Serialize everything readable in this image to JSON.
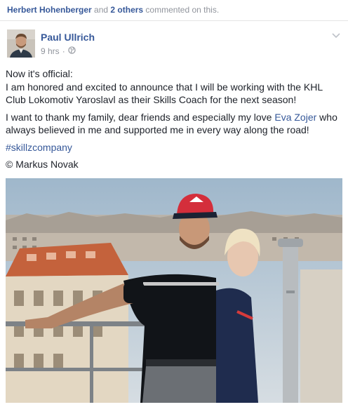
{
  "context": {
    "name1": "Herbert Hohenberger",
    "and": " and ",
    "others": "2 others",
    "suffix": " commented on this."
  },
  "post": {
    "author": "Paul Ullrich",
    "time": "9 hrs",
    "separator": "·",
    "audience_icon": "globe-icon",
    "menu_icon": "chevron-down-icon",
    "line1": "Now it's official:",
    "line2": "I am honored and excited to announce that I will be working with the KHL Club Lokomotiv Yaroslavl as their Skills Coach for the next season!",
    "para2_before": "I want to thank my family, dear friends and especially my love ",
    "para2_link": "Eva Zojer",
    "para2_after": " who always believed in me and supported me in every way along the road!",
    "hashtag": "#skillzcompany",
    "credit": "© Markus Novak"
  },
  "colors": {
    "link": "#365899",
    "text": "#1d2129",
    "muted": "#90949c"
  }
}
